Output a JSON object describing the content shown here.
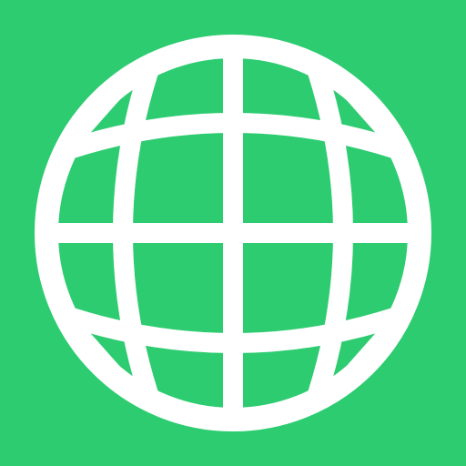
{
  "icon": {
    "name": "globe-icon",
    "background_color": "#2ecc71",
    "foreground_color": "#ffffff"
  }
}
